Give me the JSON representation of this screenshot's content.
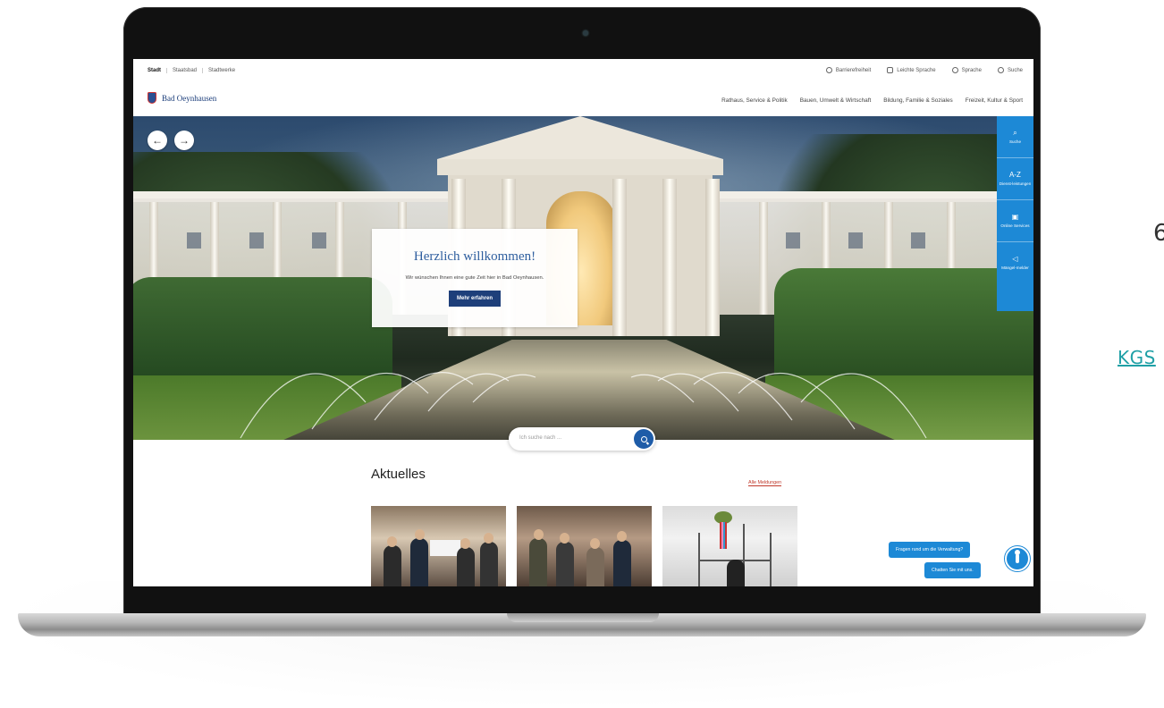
{
  "background_text": {
    "cut_number": "6",
    "cut_link": "KGS"
  },
  "colors": {
    "brand_blue": "#1e3f7a",
    "accent_blue": "#1d89d6",
    "link_red": "#c0392b"
  },
  "utility_bar": {
    "left": [
      "Stadt",
      "Staatsbad",
      "Stadtwerke"
    ],
    "right": [
      {
        "icon": "accessibility-icon",
        "label": "Barrierefreiheit"
      },
      {
        "icon": "easy-language-icon",
        "label": "Leichte Sprache"
      },
      {
        "icon": "globe-icon",
        "label": "Sprache"
      },
      {
        "icon": "search-icon",
        "label": "Suche"
      }
    ]
  },
  "header": {
    "brand": "Bad Oeynhausen",
    "nav": [
      "Rathaus, Service & Politik",
      "Bauen, Umwelt & Wirtschaft",
      "Bildung, Familie & Soziales",
      "Freizeit, Kultur & Sport"
    ]
  },
  "hero": {
    "prev_icon": "arrow-left-icon",
    "next_icon": "arrow-right-icon",
    "title": "Herzlich willkommen!",
    "text": "Wir wünschen Ihnen eine gute Zeit hier in Bad Oeynhausen.",
    "cta": "Mehr erfahren"
  },
  "sidebar": [
    {
      "icon": "search-icon",
      "label": "Suche",
      "glyph": "⌕"
    },
    {
      "icon": "az-icon",
      "label": "Dienst-leistungen",
      "glyph": "A-Z"
    },
    {
      "icon": "online-services-icon",
      "label": "Online Services",
      "glyph": "▣"
    },
    {
      "icon": "megaphone-icon",
      "label": "Mängel-melder",
      "glyph": "◁"
    }
  ],
  "search": {
    "placeholder": "Ich suche nach ..."
  },
  "news": {
    "title": "Aktuelles",
    "all_link": "Alle Meldungen"
  },
  "chat": {
    "question": "Fragen rund um die Verwaltung?",
    "answer": "Chatten Sie mit uns."
  }
}
